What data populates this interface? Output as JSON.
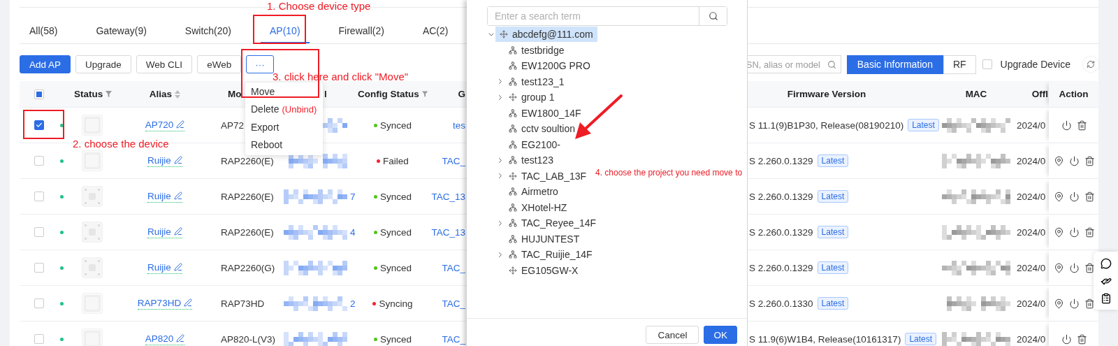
{
  "top_tabs": [
    {
      "label": "All(58)",
      "selected": false
    },
    {
      "label": "Gateway(9)",
      "selected": false
    },
    {
      "label": "Switch(20)",
      "selected": false
    },
    {
      "label": "AP(10)",
      "selected": true
    },
    {
      "label": "Firewall(2)",
      "selected": false
    },
    {
      "label": "AC(2)",
      "selected": false
    }
  ],
  "toolbar": {
    "buttons": [
      {
        "label": "Add AP",
        "kind": "primary"
      },
      {
        "label": "Upgrade",
        "kind": "default"
      },
      {
        "label": "Web CLI",
        "kind": "default"
      },
      {
        "label": "eWeb",
        "kind": "default"
      },
      {
        "label": "···",
        "kind": "more"
      }
    ],
    "search": {
      "placeholder": "SN, alias or model"
    },
    "view_toggle": [
      {
        "label": "Basic Information",
        "selected": true
      },
      {
        "label": "RF",
        "selected": false
      }
    ],
    "upgrade_device": {
      "label": "Upgrade Device",
      "checked": false
    }
  },
  "more_menu": {
    "items": [
      {
        "label": "Move"
      },
      {
        "label": "Delete",
        "note": "(Unbind)"
      },
      {
        "label": "Export"
      },
      {
        "label": "Reboot"
      }
    ]
  },
  "table": {
    "select_all": {
      "indeterminate": true
    },
    "columns_left": [
      {
        "label": "Status",
        "kind": "filter"
      },
      {
        "label": "Alias",
        "kind": "sort"
      },
      {
        "label": "Mo",
        "kind": "plain"
      },
      {
        "label": "l",
        "kind": "plain"
      },
      {
        "label": "Config Status",
        "kind": "filter"
      },
      {
        "label": "G",
        "kind": "plain"
      }
    ],
    "columns_right": [
      {
        "label": "Firmware Version"
      },
      {
        "label": "MAC"
      },
      {
        "label": "Offl"
      },
      {
        "label": "Action"
      }
    ],
    "rows": [
      {
        "checked": true,
        "online": true,
        "alias": "AP720",
        "model": "AP72",
        "config_status": "Synced",
        "color": "#52c41a",
        "group": "tes",
        "firmware": "S 11.1(9)B1P30, Release(08190210)",
        "firmware_badge": "Latest",
        "offline_time": "2024/0",
        "locatable": false
      },
      {
        "checked": false,
        "online": true,
        "alias": "Ruijie",
        "model": "RAP2260(E)",
        "config_status": "Failed",
        "color": "#f5222d",
        "group": "TAC_",
        "firmware": "S 2.260.0.1329",
        "firmware_badge": "Latest",
        "offline_time": "2024/0",
        "locatable": true
      },
      {
        "checked": false,
        "online": true,
        "alias": "Ruijie",
        "model": "RAP2260(E)",
        "sn_tail": "7",
        "config_status": "Synced",
        "color": "#52c41a",
        "group": "TAC_13",
        "firmware": "S 2.260.0.1329",
        "firmware_badge": "Latest",
        "offline_time": "2024/0",
        "locatable": true
      },
      {
        "checked": false,
        "online": true,
        "alias": "Ruijie",
        "model": "RAP2260(E)",
        "sn_tail": "4",
        "config_status": "Synced",
        "color": "#52c41a",
        "group": "TAC_13",
        "firmware": "S 2.260.0.1329",
        "firmware_badge": "Latest",
        "offline_time": "2024/0",
        "locatable": true
      },
      {
        "checked": false,
        "online": true,
        "alias": "Ruijie",
        "model": "RAP2260(G)",
        "config_status": "Synced",
        "color": "#52c41a",
        "group": "TAC_",
        "firmware": "S 2.260.0.1329",
        "firmware_badge": "Latest",
        "offline_time": "2024/0",
        "locatable": true
      },
      {
        "checked": false,
        "online": true,
        "alias": "RAP73HD",
        "model": "RAP73HD",
        "sn_tail": "2",
        "config_status": "Syncing",
        "color": "#f5222d",
        "group": "TAC_",
        "firmware": "S 2.260.0.1330",
        "firmware_badge": "Latest",
        "offline_time": "2024/0",
        "locatable": true
      },
      {
        "checked": false,
        "online": true,
        "alias": "AP820",
        "model": "AP820-L(V3)",
        "config_status": "Synced",
        "color": "#52c41a",
        "group": "TAC_",
        "firmware": "S 11.9(6)W1B4, Release(10161317)",
        "firmware_badge": "Latest",
        "offline_time": "2024/0",
        "locatable": false
      }
    ]
  },
  "move_dialog": {
    "search": {
      "placeholder": "Enter a search term"
    },
    "tree": {
      "label": "abcdefg@111.com",
      "kind": "group",
      "selected": true,
      "expanded": true,
      "children": [
        {
          "label": "testbridge",
          "kind": "project",
          "selected": false
        },
        {
          "label": "EW1200G PRO",
          "kind": "project",
          "selected": false
        },
        {
          "label": "test123_1",
          "kind": "project",
          "selected": false,
          "expanded": false
        },
        {
          "label": "group 1",
          "kind": "group",
          "selected": false,
          "expanded": false
        },
        {
          "label": "EW1800_14F",
          "kind": "project",
          "selected": false
        },
        {
          "label": "cctv soultion",
          "kind": "project",
          "selected": false
        },
        {
          "label": "EG2100-",
          "kind": "project",
          "selected": false
        },
        {
          "label": "test123",
          "kind": "project",
          "selected": false,
          "expanded": false
        },
        {
          "label": "TAC_LAB_13F",
          "kind": "group",
          "selected": false,
          "expanded": false
        },
        {
          "label": "Airmetro",
          "kind": "project",
          "selected": false
        },
        {
          "label": "XHotel-HZ",
          "kind": "project",
          "selected": false
        },
        {
          "label": "TAC_Reyee_14F",
          "kind": "project",
          "selected": false,
          "expanded": false
        },
        {
          "label": "HUJUNTEST",
          "kind": "project",
          "selected": false
        },
        {
          "label": "TAC_Ruijie_14F",
          "kind": "project",
          "selected": false,
          "expanded": false
        },
        {
          "label": "EG105GW-X",
          "kind": "group",
          "selected": false
        }
      ]
    },
    "buttons": [
      {
        "label": "Cancel",
        "kind": "default"
      },
      {
        "label": "OK",
        "kind": "primary"
      }
    ]
  },
  "annotations": [
    {
      "kind": "note",
      "text": "1. Choose device type"
    },
    {
      "kind": "note",
      "text": "2. choose the device"
    },
    {
      "kind": "note",
      "text": "3. click here and click \"Move\""
    },
    {
      "kind": "note",
      "text": "4. choose the project you need move to"
    }
  ]
}
